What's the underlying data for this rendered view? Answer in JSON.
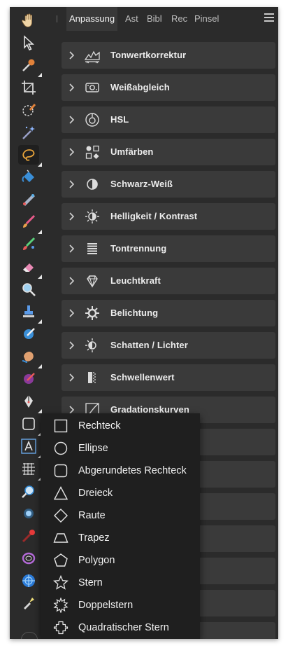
{
  "panel": {
    "tabs": [
      {
        "label": "Anpassung",
        "active": true
      },
      {
        "label": "Ast",
        "active": false
      },
      {
        "label": "Bibl",
        "active": false
      },
      {
        "label": "Rec",
        "active": false
      },
      {
        "label": "Pinsel",
        "active": false
      }
    ],
    "adjustments": [
      {
        "label": "Tonwertkorrektur",
        "icon": "levels-icon"
      },
      {
        "label": "Weißabgleich",
        "icon": "white-balance-icon"
      },
      {
        "label": "HSL",
        "icon": "hsl-icon"
      },
      {
        "label": "Umfärben",
        "icon": "recolor-icon"
      },
      {
        "label": "Schwarz-Weiß",
        "icon": "black-white-icon"
      },
      {
        "label": "Helligkeit / Kontrast",
        "icon": "brightness-contrast-icon"
      },
      {
        "label": "Tontrennung",
        "icon": "posterize-icon"
      },
      {
        "label": "Leuchtkraft",
        "icon": "vibrance-icon"
      },
      {
        "label": "Belichtung",
        "icon": "exposure-icon"
      },
      {
        "label": "Schatten / Lichter",
        "icon": "shadows-highlights-icon"
      },
      {
        "label": "Schwellenwert",
        "icon": "threshold-icon"
      },
      {
        "label": "Gradationskurven",
        "icon": "curves-icon"
      }
    ]
  },
  "shape_flyout": {
    "items": [
      {
        "label": "Rechteck",
        "icon": "rectangle-icon"
      },
      {
        "label": "Ellipse",
        "icon": "ellipse-icon"
      },
      {
        "label": "Abgerundetes Rechteck",
        "icon": "rounded-rectangle-icon"
      },
      {
        "label": "Dreieck",
        "icon": "triangle-icon"
      },
      {
        "label": "Raute",
        "icon": "diamond-icon"
      },
      {
        "label": "Trapez",
        "icon": "trapezoid-icon"
      },
      {
        "label": "Polygon",
        "icon": "polygon-icon"
      },
      {
        "label": "Stern",
        "icon": "star-icon"
      },
      {
        "label": "Doppelstern",
        "icon": "double-star-icon"
      },
      {
        "label": "Quadratischer Stern",
        "icon": "square-star-icon"
      }
    ]
  },
  "toolbar": {
    "active_tool": "freehand-selection-tool",
    "accent_color": "#e8a33a",
    "tools": [
      "view-tool",
      "move-tool",
      "color-picker-tool",
      "crop-tool",
      "selection-brush-tool",
      "flood-select-tool",
      "freehand-selection-tool",
      "flood-fill-tool",
      "gradient-tool",
      "paint-brush-tool",
      "paint-mixer-brush-tool",
      "erase-brush-tool",
      "zoom-tool",
      "clone-brush-tool",
      "dodge-brush-tool",
      "smudge-brush-tool",
      "burn-brush-tool",
      "pen-tool",
      "rectangle-tool",
      "artistic-text-tool",
      "mesh-warp-tool",
      "zoom-lens-tool",
      "blur-brush-tool",
      "red-eye-tool",
      "lasso-ring-tool",
      "liquify-tool",
      "flashlight-tool"
    ]
  }
}
